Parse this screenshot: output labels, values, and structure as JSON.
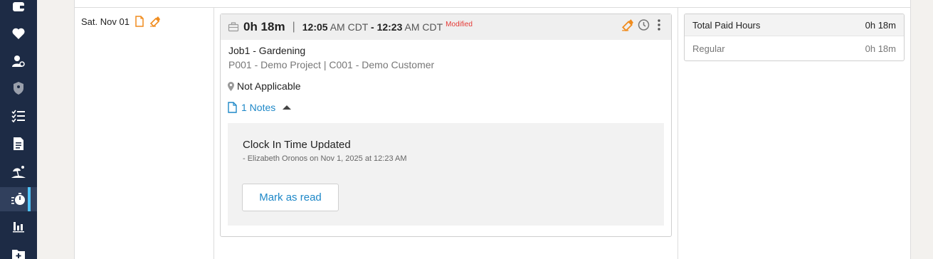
{
  "sidebar": {
    "items": [
      {
        "icon": "wallet-icon",
        "active": false
      },
      {
        "icon": "heart-icon",
        "active": false
      },
      {
        "icon": "user-search-icon",
        "active": false
      },
      {
        "icon": "shield-icon",
        "active": false
      },
      {
        "icon": "checklist-icon",
        "active": false
      },
      {
        "icon": "document-icon",
        "active": false
      },
      {
        "icon": "beach-icon",
        "active": false
      },
      {
        "icon": "stopwatch-icon",
        "active": true
      },
      {
        "icon": "bar-chart-icon",
        "active": false
      },
      {
        "icon": "folder-add-icon",
        "active": false
      }
    ]
  },
  "day": {
    "date": "Sat. Nov 01"
  },
  "entry": {
    "duration": "0h 18m",
    "separator": "|",
    "start_time": "12:05",
    "start_suffix": "AM CDT",
    "dash": "-",
    "end_time": "12:23",
    "end_suffix": "AM CDT",
    "modified": "Modified",
    "job": "Job1 - Gardening",
    "project": "P001 - Demo Project | C001 - Demo Customer",
    "location": "Not Applicable",
    "notes_label": "1 Notes",
    "note": {
      "title": "Clock In Time Updated",
      "meta": "-  Elizabeth Oronos on Nov 1, 2025 at 12:23 AM",
      "button": "Mark as read"
    }
  },
  "summary": {
    "total_label": "Total Paid Hours",
    "total_value": "0h 18m",
    "regular_label": "Regular",
    "regular_value": "0h 18m"
  },
  "colors": {
    "sidebar": "#1d2b45",
    "accent": "#1e88c8",
    "warning": "#f08c1e",
    "modified": "#e53935"
  }
}
